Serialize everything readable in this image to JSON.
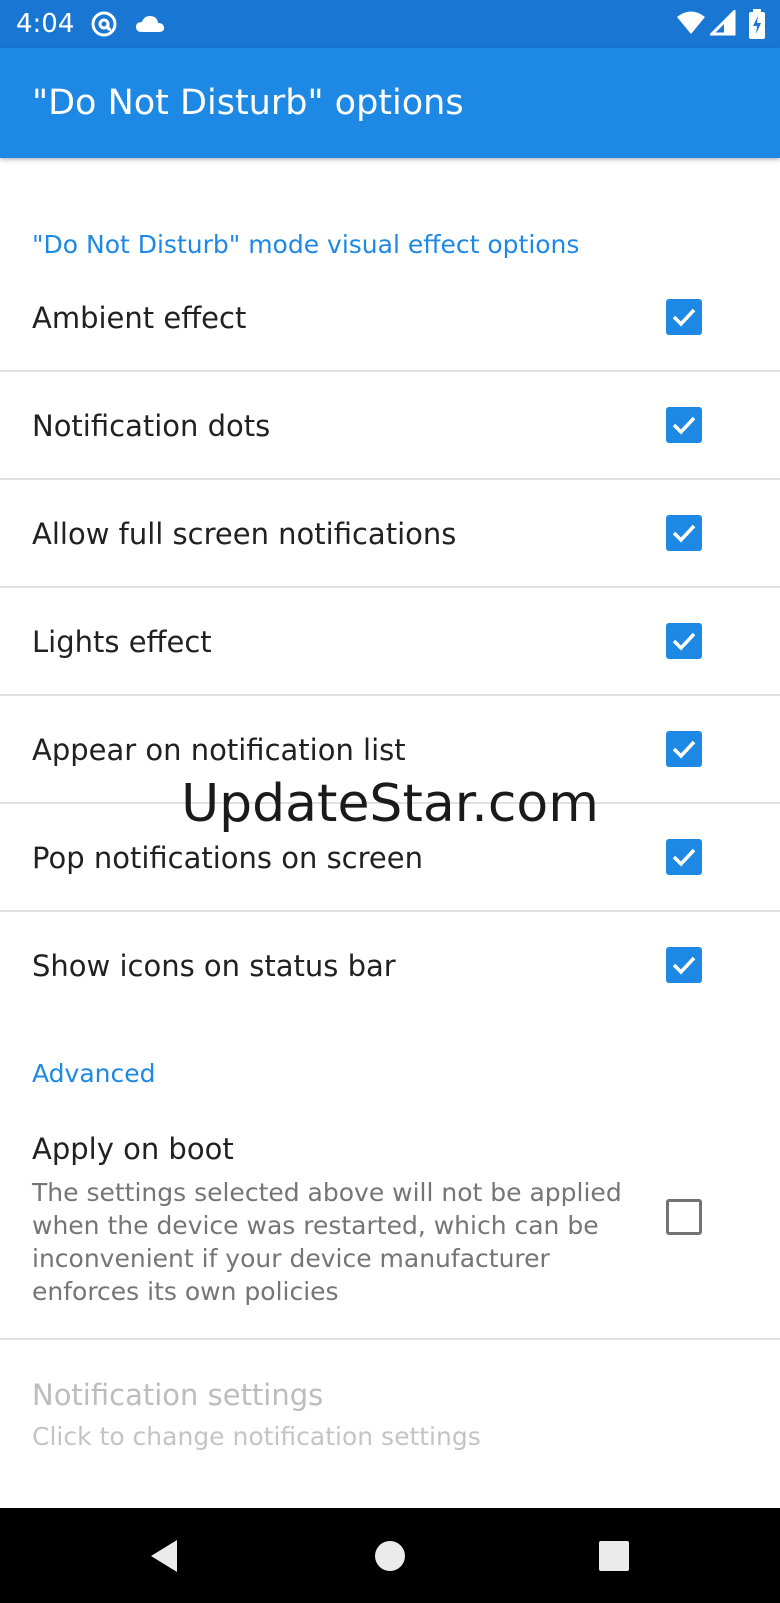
{
  "status_bar": {
    "time": "4:04",
    "icons": [
      "at-sign-icon",
      "cloud-icon",
      "wifi-icon",
      "signal-icon",
      "battery-charging-icon"
    ]
  },
  "app_bar": {
    "title": "\"Do Not Disturb\" options"
  },
  "sections": {
    "visual_header": "\"Do Not Disturb\" mode visual effect options",
    "advanced_header": "Advanced"
  },
  "options": [
    {
      "label": "Ambient effect",
      "checked": true
    },
    {
      "label": "Notification dots",
      "checked": true
    },
    {
      "label": "Allow full screen notifications",
      "checked": true
    },
    {
      "label": "Lights effect",
      "checked": true
    },
    {
      "label": "Appear on notification list",
      "checked": true
    },
    {
      "label": "Pop notifications on screen",
      "checked": true
    },
    {
      "label": "Show icons on status bar",
      "checked": true
    }
  ],
  "advanced": {
    "apply_on_boot": {
      "title": "Apply on boot",
      "description": "The settings selected above will not be applied when the device was restarted, which can be inconvenient if your device manufacturer enforces its own policies",
      "checked": false
    },
    "notification_settings": {
      "title": "Notification settings",
      "description": "Click to change notification settings"
    }
  },
  "watermark": "UpdateStar.com",
  "colors": {
    "status_bar": "#1976d2",
    "app_bar": "#1e88e5",
    "accent": "#1e88e5"
  },
  "nav_bar": {
    "icons": [
      "back-icon",
      "home-icon",
      "recents-icon"
    ]
  }
}
